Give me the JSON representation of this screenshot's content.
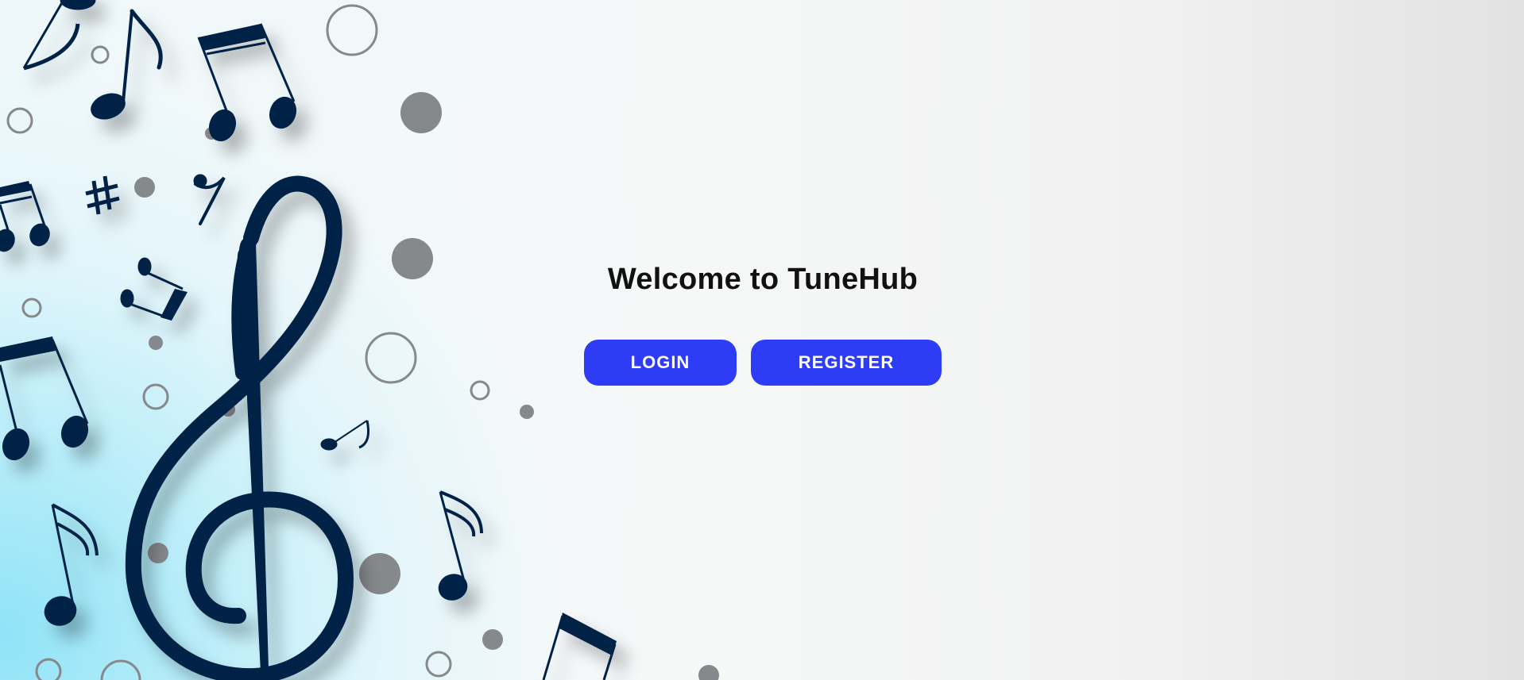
{
  "page": {
    "heading": "Welcome to TuneHub"
  },
  "buttons": {
    "login_label": "LOGIN",
    "register_label": "REGISTER"
  },
  "colors": {
    "button_bg": "#2f3cf6",
    "button_text": "#ffffff",
    "heading_text": "#111111",
    "note_color": "#032447",
    "dot_color": "#85898b"
  },
  "decoration": {
    "icons": [
      "treble-clef-icon",
      "eighth-note-icon",
      "beamed-notes-icon",
      "sharp-icon",
      "rest-icon",
      "circle-dot-icon",
      "ring-icon"
    ]
  }
}
